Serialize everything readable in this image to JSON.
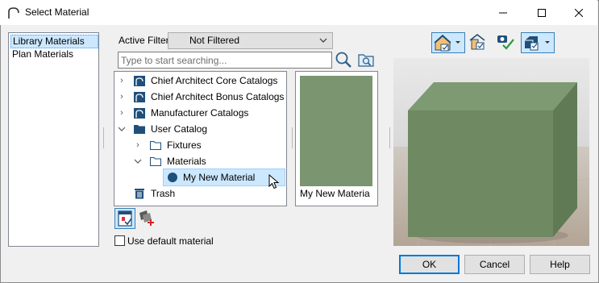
{
  "window": {
    "title": "Select Material",
    "controls": [
      "minimize",
      "maximize",
      "close"
    ]
  },
  "left_list": {
    "items": [
      {
        "label": "Library Materials",
        "selected": true
      },
      {
        "label": "Plan Materials",
        "selected": false
      }
    ]
  },
  "filter": {
    "label": "Active Filter:",
    "value": "Not Filtered"
  },
  "search": {
    "placeholder": "Type to start searching..."
  },
  "tree": {
    "items": [
      {
        "label": "Chief Architect Core Catalogs",
        "icon": "catalog-book-icon",
        "toggle": "collapsed"
      },
      {
        "label": "Chief Architect Bonus Catalogs",
        "icon": "catalog-book-icon",
        "toggle": "collapsed"
      },
      {
        "label": "Manufacturer Catalogs",
        "icon": "catalog-book-icon",
        "toggle": "collapsed"
      },
      {
        "label": "User Catalog",
        "icon": "folder-filled-icon",
        "toggle": "expanded"
      },
      {
        "label": "Fixtures",
        "icon": "folder-outline-icon",
        "toggle": "collapsed"
      },
      {
        "label": "Materials",
        "icon": "folder-outline-icon",
        "toggle": "expanded"
      },
      {
        "label": "My New Material",
        "icon": "material-dot-icon",
        "toggle": "none",
        "selected": true
      },
      {
        "label": "Trash",
        "icon": "trash-icon",
        "toggle": "none"
      }
    ]
  },
  "preview_tile": {
    "label": "My New Materia",
    "swatch_color": "#7a9570"
  },
  "options": {
    "use_default_label": "Use default material",
    "use_default_checked": false
  },
  "buttons": {
    "ok": "OK",
    "cancel": "Cancel",
    "help": "Help"
  },
  "colors": {
    "selection": "#cce8ff",
    "material": "#6f8a62",
    "accent": "#0078d7"
  }
}
